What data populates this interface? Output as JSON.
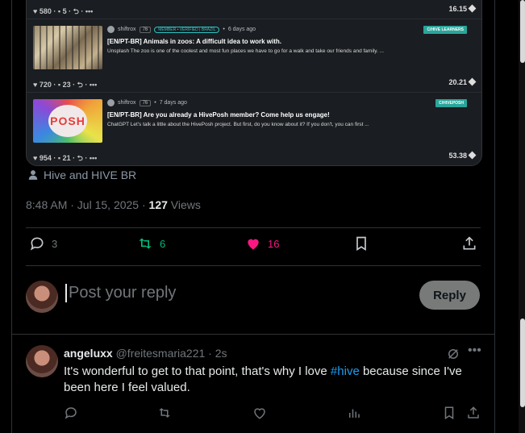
{
  "embed": {
    "posts": [
      {
        "stats": {
          "likes": "580",
          "comments": "5",
          "payout": "16.15"
        }
      },
      {
        "author": "shiftrox",
        "rep": "76",
        "member_badge": "MEMBER • VERIFIED | BRAZIL",
        "time": "6 days ago",
        "community": "C/HIVE LEARNERS",
        "title": "[EN/PT-BR] Animals in zoos: A difficult idea to work with.",
        "excerpt": "Unsplash The zoo is one of the coolest and most fun places we have to go for a walk and take our friends and family. ...",
        "stats": {
          "likes": "720",
          "comments": "23",
          "payout": "20.21"
        }
      },
      {
        "author": "shiftrox",
        "rep": "76",
        "time": "7 days ago",
        "community": "C/HIVEPOSH",
        "thumb_text": "POSH",
        "title": "[EN/PT-BR] Are you already a HivePosh member? Come help us engage!",
        "excerpt": "ChatGPT Let's talk a little about the HivePosh project. But first, do you know about it? If you don't, you can first ...",
        "stats": {
          "likes": "954",
          "comments": "21",
          "payout": "53.38"
        }
      }
    ],
    "ellipsis": "•••"
  },
  "tweet": {
    "location": "Hive and HIVE BR",
    "time": "8:48 AM · Jul 15, 2025 · ",
    "views_count": "127",
    "views_label": " Views",
    "replies": "3",
    "reposts": "6",
    "likes": "16"
  },
  "composer": {
    "placeholder": "Post your reply",
    "button": "Reply"
  },
  "reply": {
    "name": "angeluxx",
    "handle": "@freitesmaria221 · 2s",
    "text_before": "It's wonderful to get to that point, that's why I love ",
    "hashtag": "#hive",
    "text_after": " because since I've been here I feel valued."
  },
  "colors": {
    "like": "#f91880",
    "repost": "#00ba7c",
    "link": "#1d9bf0",
    "community": "#2aa59b"
  }
}
